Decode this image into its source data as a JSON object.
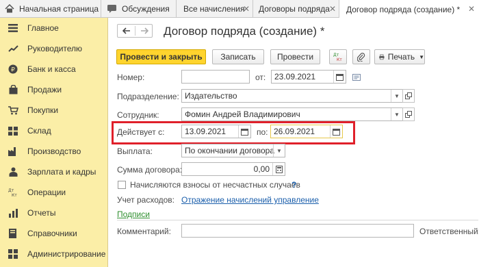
{
  "tabs": [
    {
      "label": "Начальная страница",
      "icon": "home-icon",
      "closable": false,
      "active": false
    },
    {
      "label": "Обсуждения",
      "icon": "chat-icon",
      "closable": false,
      "active": false
    },
    {
      "label": "Все начисления",
      "closable": true,
      "active": false
    },
    {
      "label": "Договоры подряда",
      "closable": true,
      "active": false
    },
    {
      "label": "Договор подряда (создание) *",
      "closable": true,
      "active": true
    }
  ],
  "sidebar": {
    "items": [
      {
        "label": "Главное",
        "icon": "menu-icon"
      },
      {
        "label": "Руководителю",
        "icon": "trend-icon"
      },
      {
        "label": "Банк и касса",
        "icon": "coin-icon"
      },
      {
        "label": "Продажи",
        "icon": "bag-icon"
      },
      {
        "label": "Покупки",
        "icon": "cart-icon"
      },
      {
        "label": "Склад",
        "icon": "warehouse-icon"
      },
      {
        "label": "Производство",
        "icon": "factory-icon"
      },
      {
        "label": "Зарплата и кадры",
        "icon": "people-icon"
      },
      {
        "label": "Операции",
        "icon": "dt-kt-icon"
      },
      {
        "label": "Отчеты",
        "icon": "chart-icon"
      },
      {
        "label": "Справочники",
        "icon": "book-icon"
      },
      {
        "label": "Администрирование",
        "icon": "gear-icon"
      }
    ]
  },
  "document": {
    "title": "Договор подряда (создание) *",
    "toolbar": {
      "post_close": "Провести и закрыть",
      "save": "Записать",
      "post": "Провести",
      "print": "Печать",
      "dtkt_top": "Дт",
      "dtkt_bottom": "Кт"
    },
    "form": {
      "number_label": "Номер:",
      "number_value": "",
      "date_from_label": "от:",
      "date_from_value": "23.09.2021",
      "department_label": "Подразделение:",
      "department_value": "Издательство",
      "employee_label": "Сотрудник:",
      "employee_value": "Фомин Андрей Владимирович",
      "valid_label": "Действует с:",
      "valid_from": "13.09.2021",
      "valid_to_label": "по:",
      "valid_to": "26.09.2021",
      "payment_label": "Выплата:",
      "payment_value": "По окончании договора",
      "amount_label": "Сумма договора:",
      "amount_value": "0,00",
      "insurance_checkbox_label": "Начисляются взносы от несчастных случаев",
      "insurance_checked": false,
      "help_mark": "?",
      "expense_label": "Учет расходов:",
      "expense_link": "Отражение начислений управление",
      "signatures_link": "Подписи",
      "comment_label": "Комментарий:",
      "comment_value": "",
      "responsible_label": "Ответственный:"
    }
  },
  "colors": {
    "sidebar_bg": "#fbeea7",
    "primary_button": "#ffd42e",
    "highlight_frame": "#e0202a",
    "link": "#1a5eab"
  }
}
